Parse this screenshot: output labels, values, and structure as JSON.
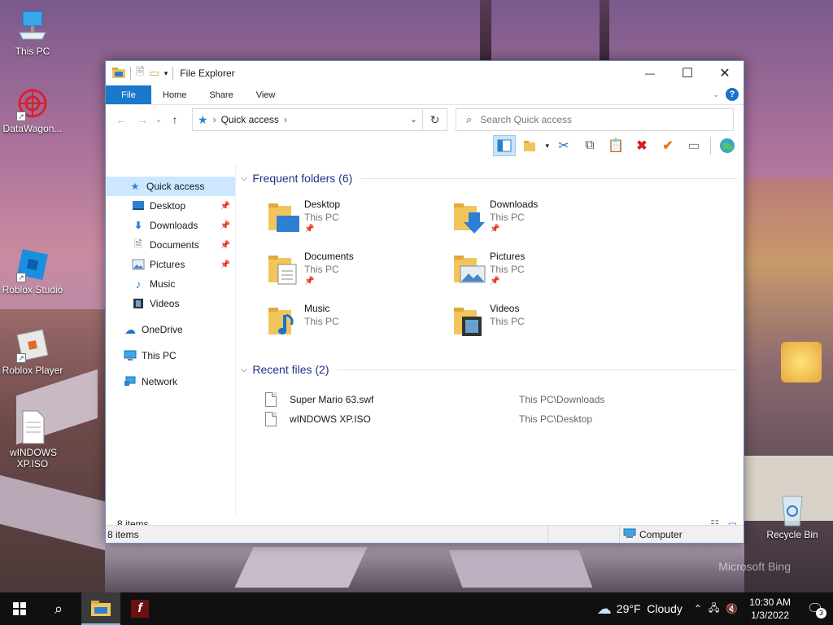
{
  "desktop": {
    "icons": [
      {
        "label": "This PC"
      },
      {
        "label": "DataWagon..."
      },
      {
        "label": "Roblox Studio"
      },
      {
        "label": "Roblox Player"
      },
      {
        "label": "wINDOWS XP.ISO"
      },
      {
        "label": "Recycle Bin"
      }
    ],
    "watermark": "Microsoft Bing"
  },
  "window": {
    "title": "File Explorer",
    "controls": {
      "minimize": "—",
      "maximize": "☐",
      "close": "✕"
    },
    "ribbon": {
      "tabs": [
        "File",
        "Home",
        "Share",
        "View"
      ],
      "help": "?"
    },
    "nav": {
      "back": "←",
      "forward": "→",
      "recent": "⌄",
      "up": "↑",
      "address": "Quick access",
      "search_placeholder": "Search Quick access"
    },
    "sidebar": {
      "items": [
        {
          "label": "Quick access"
        },
        {
          "label": "Desktop"
        },
        {
          "label": "Downloads"
        },
        {
          "label": "Documents"
        },
        {
          "label": "Pictures"
        },
        {
          "label": "Music"
        },
        {
          "label": "Videos"
        },
        {
          "label": "OneDrive"
        },
        {
          "label": "This PC"
        },
        {
          "label": "Network"
        }
      ]
    },
    "frequent": {
      "heading": "Frequent folders (6)",
      "folders": [
        {
          "name": "Desktop",
          "location": "This PC"
        },
        {
          "name": "Downloads",
          "location": "This PC"
        },
        {
          "name": "Documents",
          "location": "This PC"
        },
        {
          "name": "Pictures",
          "location": "This PC"
        },
        {
          "name": "Music",
          "location": "This PC"
        },
        {
          "name": "Videos",
          "location": "This PC"
        }
      ]
    },
    "recent": {
      "heading": "Recent files (2)",
      "files": [
        {
          "name": "Super Mario 63.swf",
          "path": "This PC\\Downloads"
        },
        {
          "name": "wINDOWS XP.ISO",
          "path": "This PC\\Desktop"
        }
      ]
    },
    "item_count": "8 items",
    "status": {
      "left": "8 items",
      "right": "Computer"
    }
  },
  "taskbar": {
    "weather": "29°F  Cloudy",
    "time": "10:30 AM",
    "date": "1/3/2022",
    "notifications": "3"
  }
}
